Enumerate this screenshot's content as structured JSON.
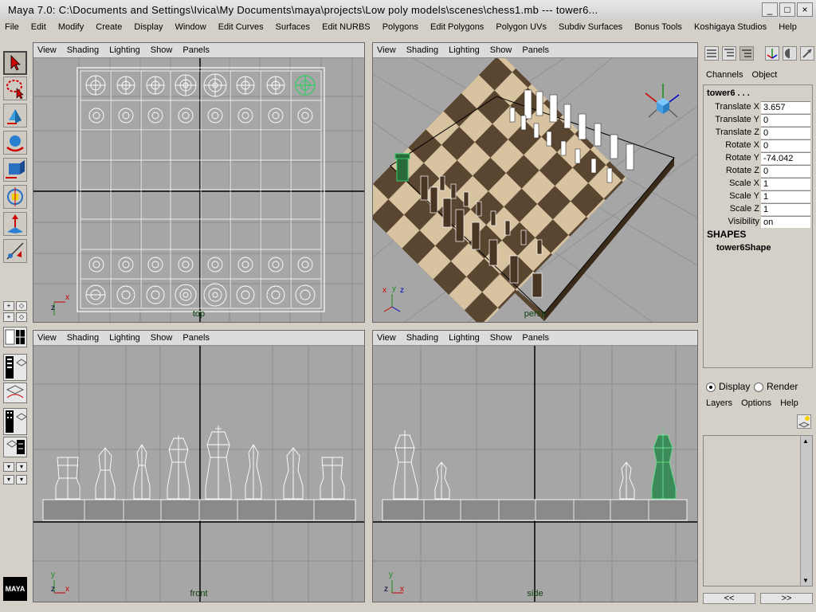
{
  "window": {
    "title": "Maya 7.0: C:\\Documents and Settings\\Ivica\\My Documents\\maya\\projects\\Low poly models\\scenes\\chess1.mb   ---   tower6...",
    "buttons": {
      "minimize": "_",
      "maximize": "□",
      "close": "×"
    }
  },
  "menubar": {
    "items": [
      "File",
      "Edit",
      "Modify",
      "Create",
      "Display",
      "Window",
      "Edit Curves",
      "Surfaces",
      "Edit NURBS",
      "Polygons",
      "Edit Polygons",
      "Polygon UVs",
      "Subdiv Surfaces",
      "Bonus Tools",
      "Koshigaya Studios",
      "Help"
    ]
  },
  "toolbox": {
    "tools": [
      "select-tool",
      "lasso-tool",
      "move-tool",
      "rotate-tool",
      "scale-tool",
      "universal-manipulator",
      "soft-modification",
      "show-manipulator"
    ],
    "selected": "select-tool",
    "logo": "MAYA"
  },
  "viewports": [
    {
      "id": "top",
      "label": "top",
      "menu": [
        "View",
        "Shading",
        "Lighting",
        "Show",
        "Panels"
      ]
    },
    {
      "id": "persp",
      "label": "persp",
      "menu": [
        "View",
        "Shading",
        "Lighting",
        "Show",
        "Panels"
      ]
    },
    {
      "id": "front",
      "label": "front",
      "menu": [
        "View",
        "Shading",
        "Lighting",
        "Show",
        "Panels"
      ]
    },
    {
      "id": "side",
      "label": "side",
      "menu": [
        "View",
        "Shading",
        "Lighting",
        "Show",
        "Panels"
      ]
    }
  ],
  "axes": {
    "top": [
      "x",
      "z"
    ],
    "persp": [
      "x",
      "y",
      "z"
    ],
    "front": [
      "y",
      "z",
      "x"
    ],
    "side": [
      "y",
      "z",
      "x"
    ]
  },
  "channel_box": {
    "tabs": [
      "Channels",
      "Object"
    ],
    "object_name": "tower6 . . .",
    "attributes": [
      {
        "name": "Translate X",
        "value": "3.657"
      },
      {
        "name": "Translate Y",
        "value": "0"
      },
      {
        "name": "Translate Z",
        "value": "0"
      },
      {
        "name": "Rotate X",
        "value": "0"
      },
      {
        "name": "Rotate Y",
        "value": "-74.042"
      },
      {
        "name": "Rotate Z",
        "value": "0"
      },
      {
        "name": "Scale X",
        "value": "1"
      },
      {
        "name": "Scale Y",
        "value": "1"
      },
      {
        "name": "Scale Z",
        "value": "1"
      },
      {
        "name": "Visibility",
        "value": "on"
      }
    ],
    "shapes_header": "SHAPES",
    "shape_name": "tower6Shape"
  },
  "layer_editor": {
    "display_label": "Display",
    "render_label": "Render",
    "selected": "Display",
    "menu": [
      "Layers",
      "Options",
      "Help"
    ],
    "nav_prev": "<<",
    "nav_next": ">>"
  },
  "colors": {
    "viewport_bg": "#a6a6a6",
    "wireframe": "#ffffff",
    "selected_wire": "#33cc66",
    "board_light": "#d7c3a0",
    "board_dark": "#5a4530"
  }
}
